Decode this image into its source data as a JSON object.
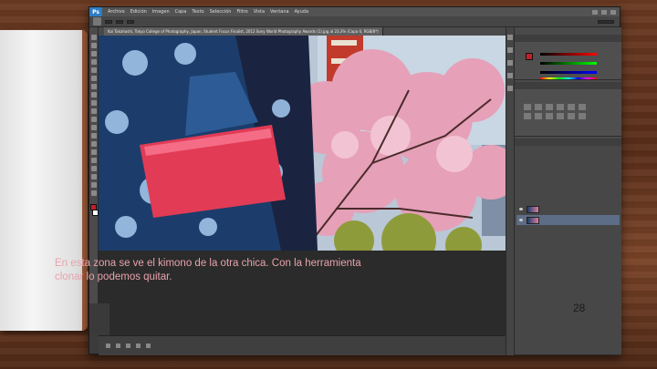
{
  "app": {
    "logo": "Ps",
    "menu": [
      "Archivo",
      "Edición",
      "Imagen",
      "Capa",
      "Texto",
      "Selección",
      "Filtro",
      "Vista",
      "Ventana",
      "Ayuda"
    ]
  },
  "document": {
    "tab_title": "Kai Takahashi, Tokyo College of Photography, Japan, Student Focus Finalist, 2012 Sony World Photography Awards (1).jpg al 23,3% (Capa 0, RGB/8*)"
  },
  "slide": {
    "caption": "En esta zona se ve el kimono de la otra chica. Con la herramienta clonar lo podemos quitar.",
    "page_number": "28"
  },
  "colors": {
    "accent_ps_blue": "#2c7dc6",
    "foreground_swatch": "#c41e2a",
    "caption_text": "#e8a3ad",
    "selected_layer": "#5e6d86"
  },
  "icons": [
    "photoshop-logo-icon",
    "brush-icon",
    "eye-icon",
    "layer-thumbnail-icon"
  ]
}
